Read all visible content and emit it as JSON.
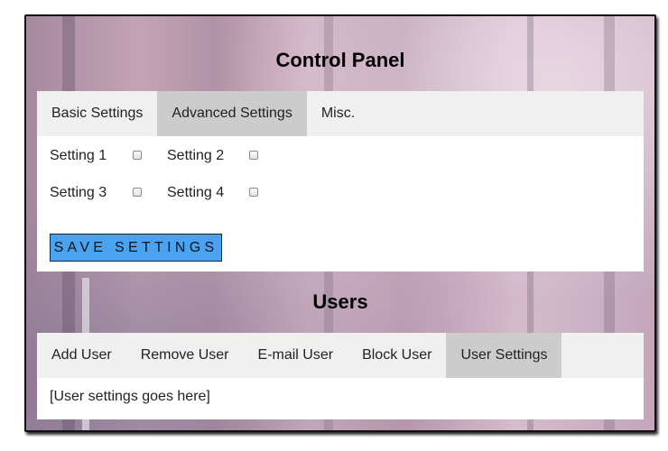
{
  "control_panel": {
    "title": "Control Panel",
    "tabs": [
      {
        "label": "Basic Settings",
        "active": false
      },
      {
        "label": "Advanced Settings",
        "active": true
      },
      {
        "label": "Misc.",
        "active": false
      }
    ],
    "settings": [
      {
        "label": "Setting 1",
        "checked": false
      },
      {
        "label": "Setting 2",
        "checked": false
      },
      {
        "label": "Setting 3",
        "checked": false
      },
      {
        "label": "Setting 4",
        "checked": false
      }
    ],
    "save_label": "SAVE SETTINGS"
  },
  "users": {
    "title": "Users",
    "tabs": [
      {
        "label": "Add User",
        "active": false
      },
      {
        "label": "Remove User",
        "active": false
      },
      {
        "label": "E-mail User",
        "active": false
      },
      {
        "label": "Block User",
        "active": false
      },
      {
        "label": "User Settings",
        "active": true
      }
    ],
    "content_text": "[User settings goes here]"
  },
  "colors": {
    "save_button": "#4aa3f0",
    "tab_bar": "#f0f0f0",
    "tab_active": "#cccccc"
  }
}
